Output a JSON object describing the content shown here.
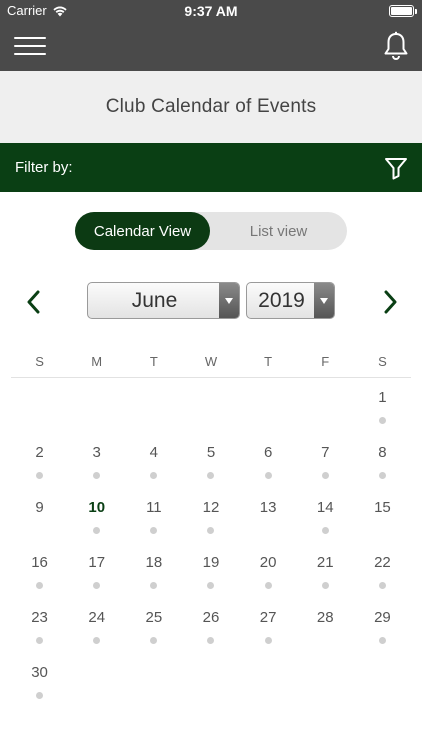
{
  "status_bar": {
    "carrier": "Carrier",
    "time": "9:37 AM"
  },
  "nav": {
    "menu_icon": "hamburger-menu-icon",
    "bell_icon": "bell-icon"
  },
  "page_title": "Club Calendar of Events",
  "filter": {
    "label": "Filter by:",
    "icon": "filter-funnel-icon"
  },
  "view_toggle": {
    "calendar_label": "Calendar View",
    "list_label": "List view",
    "selected": "Calendar View"
  },
  "month_picker": {
    "selected": "June"
  },
  "year_picker": {
    "selected": "2019"
  },
  "weekdays": [
    "S",
    "M",
    "T",
    "W",
    "T",
    "F",
    "S"
  ],
  "calendar": {
    "today": 10,
    "weeks": [
      [
        null,
        null,
        null,
        null,
        null,
        null,
        {
          "day": "1",
          "dot": true
        }
      ],
      [
        {
          "day": "2",
          "dot": true
        },
        {
          "day": "3",
          "dot": true
        },
        {
          "day": "4",
          "dot": true
        },
        {
          "day": "5",
          "dot": true
        },
        {
          "day": "6",
          "dot": true
        },
        {
          "day": "7",
          "dot": true
        },
        {
          "day": "8",
          "dot": true
        }
      ],
      [
        {
          "day": "9",
          "dot": false
        },
        {
          "day": "10",
          "dot": true
        },
        {
          "day": "11",
          "dot": true
        },
        {
          "day": "12",
          "dot": true
        },
        {
          "day": "13",
          "dot": false
        },
        {
          "day": "14",
          "dot": true
        },
        {
          "day": "15",
          "dot": false
        }
      ],
      [
        {
          "day": "16",
          "dot": true
        },
        {
          "day": "17",
          "dot": true
        },
        {
          "day": "18",
          "dot": true
        },
        {
          "day": "19",
          "dot": true
        },
        {
          "day": "20",
          "dot": true
        },
        {
          "day": "21",
          "dot": true
        },
        {
          "day": "22",
          "dot": true
        }
      ],
      [
        {
          "day": "23",
          "dot": true
        },
        {
          "day": "24",
          "dot": true
        },
        {
          "day": "25",
          "dot": true
        },
        {
          "day": "26",
          "dot": true
        },
        {
          "day": "27",
          "dot": true
        },
        {
          "day": "28",
          "dot": false
        },
        {
          "day": "29",
          "dot": true
        }
      ],
      [
        {
          "day": "30",
          "dot": true
        },
        null,
        null,
        null,
        null,
        null,
        null
      ]
    ]
  },
  "colors": {
    "header_bg": "#4a4a4a",
    "filter_bg": "#0a3f14",
    "toggle_active": "#0c3a13",
    "event_dot": "#cfcfcf"
  }
}
